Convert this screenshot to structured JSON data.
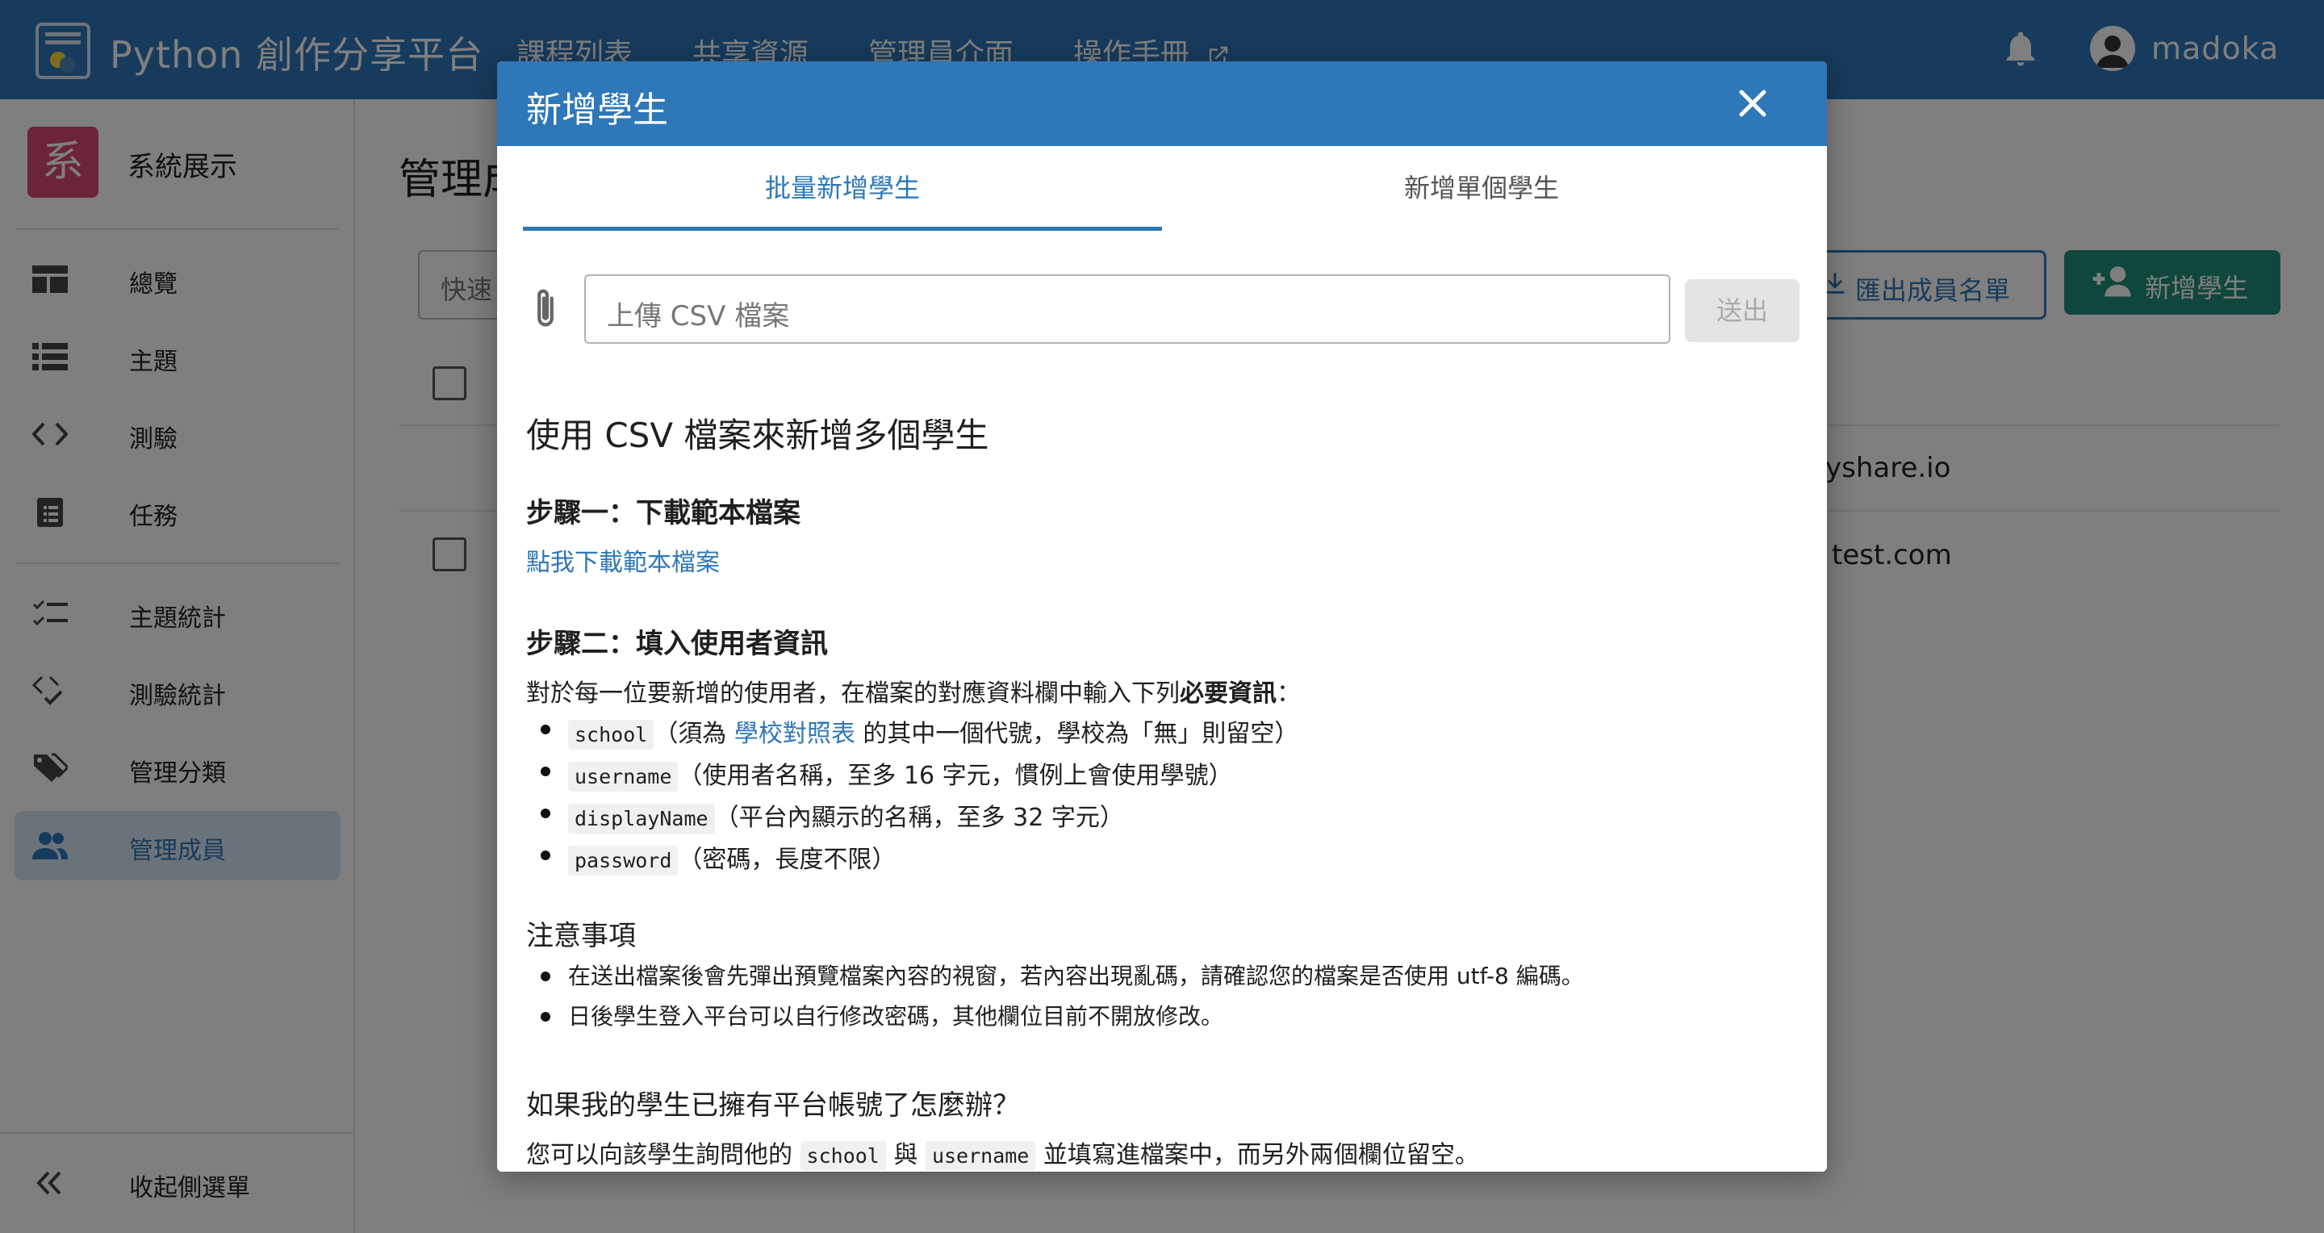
{
  "app": {
    "title": "Python 創作分享平台",
    "nav": [
      "課程列表",
      "共享資源",
      "管理員介面",
      "操作手冊"
    ],
    "user": "madoka"
  },
  "sidebar": {
    "org_badge": "系",
    "org_name": "系統展示",
    "items": [
      {
        "label": "總覽",
        "icon": "dashboard-icon"
      },
      {
        "label": "主題",
        "icon": "list-icon"
      },
      {
        "label": "測驗",
        "icon": "code-icon"
      },
      {
        "label": "任務",
        "icon": "clipboard-icon"
      },
      {
        "label": "主題統計",
        "icon": "checklist-icon"
      },
      {
        "label": "測驗統計",
        "icon": "code-check-icon"
      },
      {
        "label": "管理分類",
        "icon": "tags-icon"
      },
      {
        "label": "管理成員",
        "icon": "people-icon",
        "active": true
      }
    ],
    "collapse_label": "收起側選單"
  },
  "main": {
    "title": "管理成",
    "search_placeholder": "快速",
    "export_label": "匯出成員名單",
    "add_label": "新增學生",
    "rows": [
      "yshare.io",
      "test.com"
    ]
  },
  "modal": {
    "title": "新增學生",
    "tabs": [
      "批量新增學生",
      "新增單個學生"
    ],
    "upload_placeholder": "上傳 CSV 檔案",
    "submit_label": "送出",
    "heading": "使用 CSV 檔案來新增多個學生",
    "step1": {
      "title": "步驟一：下載範本檔案",
      "link": "點我下載範本檔案"
    },
    "step2": {
      "title": "步驟二：填入使用者資訊",
      "intro_prefix": "對於每一位要新增的使用者，在檔案的對應資料欄中輸入下列",
      "intro_bold": "必要資訊",
      "intro_suffix": "：",
      "fields": [
        {
          "code": "school",
          "pre": "（須為 ",
          "link": "學校對照表",
          "post": " 的其中一個代號，學校為「無」則留空）"
        },
        {
          "code": "username",
          "pre": "（使用者名稱，至多 16 字元，慣例上會使用學號）",
          "link": "",
          "post": ""
        },
        {
          "code": "displayName",
          "pre": "（平台內顯示的名稱，至多 32 字元）",
          "link": "",
          "post": ""
        },
        {
          "code": "password",
          "pre": "（密碼，長度不限）",
          "link": "",
          "post": ""
        }
      ]
    },
    "notes": {
      "title": "注意事項",
      "items": [
        "在送出檔案後會先彈出預覽檔案內容的視窗，若內容出現亂碼，請確認您的檔案是否使用 utf-8 編碼。",
        "日後學生登入平台可以自行修改密碼，其他欄位目前不開放修改。"
      ]
    },
    "faq": {
      "title": "如果我的學生已擁有平台帳號了怎麼辦？",
      "prefix": "您可以向該學生詢問他的 ",
      "code1": "school",
      "mid": " 與 ",
      "code2": "username",
      "suffix": " 並填寫進檔案中，而另外兩個欄位留空。"
    }
  }
}
